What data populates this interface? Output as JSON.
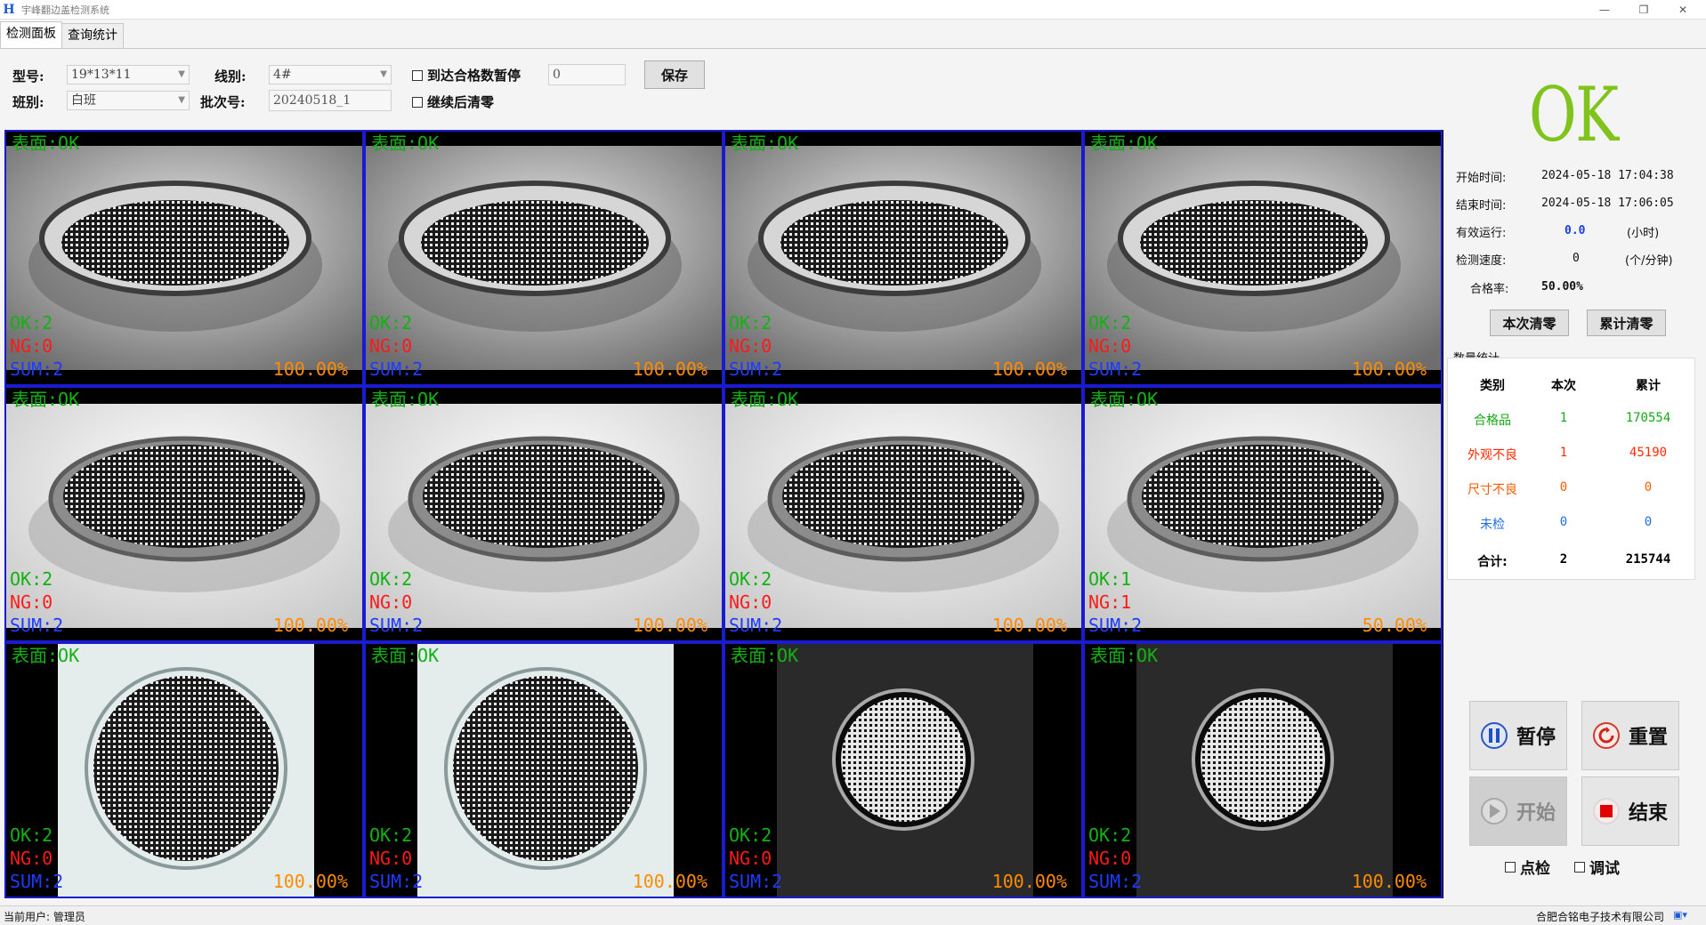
{
  "window": {
    "title": "宇峰翻边盖检测系统",
    "logo_letter": "H",
    "minimize_glyph": "—",
    "restore_glyph": "❐",
    "close_glyph": "✕"
  },
  "tabs": [
    {
      "label": "检测面板",
      "active": true
    },
    {
      "label": "查询统计",
      "active": false
    }
  ],
  "form": {
    "model_label": "型号:",
    "model_value": "19*13*11",
    "line_label": "线别:",
    "line_value": "4#",
    "shift_label": "班别:",
    "shift_value": "白班",
    "batch_label": "批次号:",
    "batch_value": "20240518_1",
    "pause_on_count_label": "到达合格数暂停",
    "pause_count_value": "0",
    "clear_after_continue_label": "继续后清零",
    "save_label": "保存"
  },
  "cameras": [
    {
      "title": "表面:OK",
      "ok": "OK:2",
      "ng": "NG:0",
      "sum": "SUM:2",
      "rate": "100.00%"
    },
    {
      "title": "表面:OK",
      "ok": "OK:2",
      "ng": "NG:0",
      "sum": "SUM:2",
      "rate": "100.00%"
    },
    {
      "title": "表面:OK",
      "ok": "OK:2",
      "ng": "NG:0",
      "sum": "SUM:2",
      "rate": "100.00%"
    },
    {
      "title": "表面:OK",
      "ok": "OK:2",
      "ng": "NG:0",
      "sum": "SUM:2",
      "rate": "100.00%"
    },
    {
      "title": "表面:OK",
      "ok": "OK:2",
      "ng": "NG:0",
      "sum": "SUM:2",
      "rate": "100.00%"
    },
    {
      "title": "表面:OK",
      "ok": "OK:2",
      "ng": "NG:0",
      "sum": "SUM:2",
      "rate": "100.00%"
    },
    {
      "title": "表面:OK",
      "ok": "OK:2",
      "ng": "NG:0",
      "sum": "SUM:2",
      "rate": "100.00%"
    },
    {
      "title": "表面:OK",
      "ok": "OK:1",
      "ng": "NG:1",
      "sum": "SUM:2",
      "rate": "50.00%"
    },
    {
      "title": "表面:OK",
      "ok": "OK:2",
      "ng": "NG:0",
      "sum": "SUM:2",
      "rate": "100.00%"
    },
    {
      "title": "表面:OK",
      "ok": "OK:2",
      "ng": "NG:0",
      "sum": "SUM:2",
      "rate": "100.00%"
    },
    {
      "title": "表面:OK",
      "ok": "OK:2",
      "ng": "NG:0",
      "sum": "SUM:2",
      "rate": "100.00%"
    },
    {
      "title": "表面:OK",
      "ok": "OK:2",
      "ng": "NG:0",
      "sum": "SUM:2",
      "rate": "100.00%"
    }
  ],
  "result": {
    "status": "OK",
    "status_color": "#7fc41d"
  },
  "info": {
    "start_label": "开始时间:",
    "start_value": "2024-05-18 17:04:38",
    "end_label": "结束时间:",
    "end_value": "2024-05-18 17:06:05",
    "runtime_label": "有效运行:",
    "runtime_value": "0.0",
    "runtime_unit": "(小时)",
    "speed_label": "检测速度:",
    "speed_value": "0",
    "speed_unit": "(个/分钟)",
    "yield_label": "合格率:",
    "yield_value": "50.00%"
  },
  "clear_buttons": {
    "clear_current_label": "本次清零",
    "clear_total_label": "累计清零"
  },
  "stats": {
    "title": "数量统计",
    "headers": [
      "类别",
      "本次",
      "累计"
    ],
    "rows": [
      {
        "category": "合格品",
        "current": "1",
        "total": "170554",
        "color": "#13a813"
      },
      {
        "category": "外观不良",
        "current": "1",
        "total": "45190",
        "color": "#ff2a00"
      },
      {
        "category": "尺寸不良",
        "current": "0",
        "total": "0",
        "color": "#ff5a00"
      },
      {
        "category": "未检",
        "current": "0",
        "total": "0",
        "color": "#1e6fe0"
      }
    ],
    "sum_label": "合计:",
    "sum_current": "2",
    "sum_total": "215744"
  },
  "controls": {
    "pause_label": "暂停",
    "reset_label": "重置",
    "start_label": "开始",
    "stop_label": "结束",
    "spot_check_label": "点检",
    "debug_label": "调试"
  },
  "statusbar": {
    "user_text": "当前用户: 管理员",
    "company_text": "合肥合铭电子技术有限公司"
  }
}
